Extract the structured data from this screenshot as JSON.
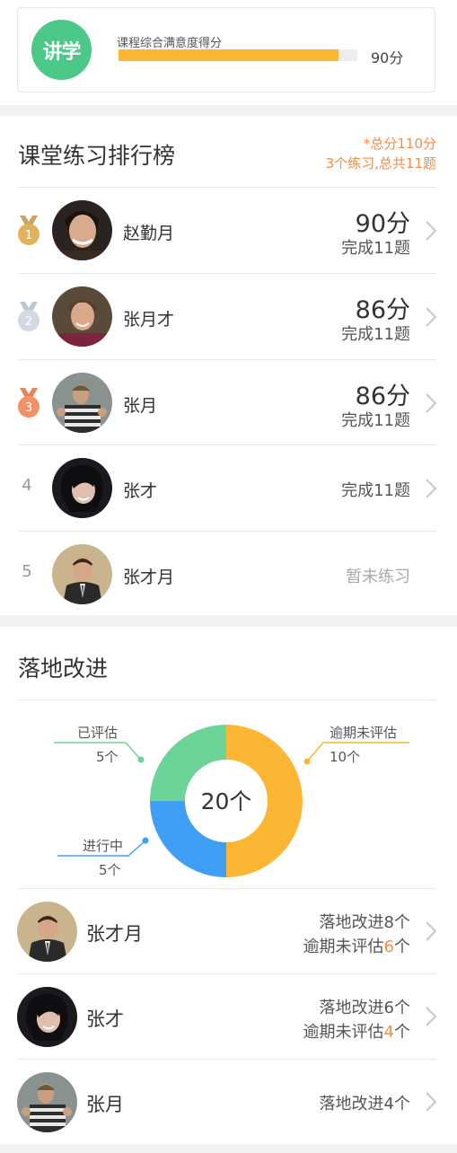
{
  "score_card": {
    "logo_text": "讲学",
    "label": "课程综合满意度得分",
    "value": "90分",
    "fill_percent": 92,
    "bar_color": "#fbb733",
    "logo_color": "#4cc889"
  },
  "ranking": {
    "title": "课堂练习排行榜",
    "note_line1": "*总分110分",
    "note_line2": "3个练习,总共11题",
    "rows": [
      {
        "rank": "1",
        "medal": "gold",
        "name": "赵勤月",
        "score": "90分",
        "done": "完成11题"
      },
      {
        "rank": "2",
        "medal": "silver",
        "name": "张月才",
        "score": "86分",
        "done": "完成11题"
      },
      {
        "rank": "3",
        "medal": "bronze",
        "name": "张月",
        "score": "86分",
        "done": "完成11题"
      },
      {
        "rank": "4",
        "medal": "",
        "name": "张才",
        "score": "",
        "done": "完成11题"
      },
      {
        "rank": "5",
        "medal": "",
        "name": "张才月",
        "score": "",
        "done": "",
        "status": "暂未练习"
      }
    ]
  },
  "improvement": {
    "title": "落地改进",
    "chart_data": {
      "type": "pie",
      "center_label": "20个",
      "segments": [
        {
          "name": "逾期未评估",
          "label": "10个",
          "value": 10,
          "color": "#fbb733"
        },
        {
          "name": "进行中",
          "label": "5个",
          "value": 5,
          "color": "#3f9ff5"
        },
        {
          "name": "已评估",
          "label": "5个",
          "value": 5,
          "color": "#6dd497"
        }
      ]
    },
    "people": [
      {
        "name": "张才月",
        "line1": "落地改进8个",
        "line2_prefix": "逾期未评估",
        "line2_num": "6",
        "line2_suffix": "个"
      },
      {
        "name": "张才",
        "line1": "落地改进6个",
        "line2_prefix": "逾期未评估",
        "line2_num": "4",
        "line2_suffix": "个"
      },
      {
        "name": "张月",
        "line1": "落地改进4个"
      }
    ]
  }
}
